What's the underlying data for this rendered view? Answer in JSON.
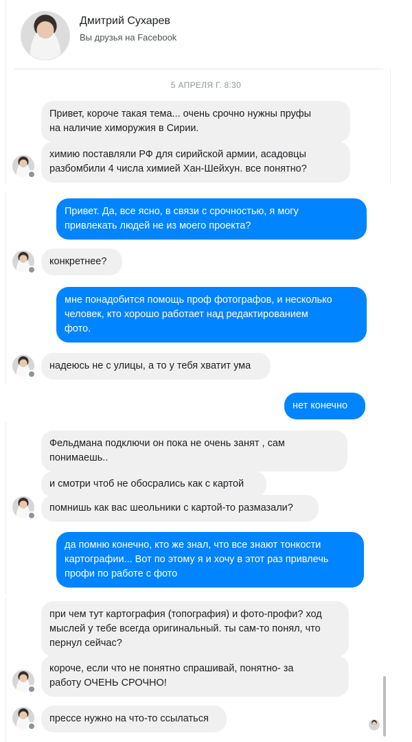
{
  "header": {
    "name": "Дмитрий Сухарев",
    "subtitle": "Вы друзья на Facebook"
  },
  "timestamp": "5 АПРЕЛЯ Г. 8:30",
  "colors": {
    "outgoing": "#0084ff",
    "incoming": "#f1f0f0"
  },
  "messages": [
    {
      "dir": "in",
      "text": "Привет, короче такая тема... очень срочно нужны пруфы\nна наличие химоружия в Сирии."
    },
    {
      "dir": "in",
      "text": "химию поставляли РФ для  сирийской армии, асадовцы\nразбомбили 4 числа химией  Хан-Шейхун. все понятно?"
    },
    {
      "dir": "out",
      "text": "Привет. Да, все ясно, в связи с срочностью, я могу\nпривлекать людей не из моего проекта?"
    },
    {
      "dir": "in",
      "text": "конкретнее?"
    },
    {
      "dir": "out",
      "text": "мне понадобится помощь проф фотографов, и несколько\nчеловек, кто хорошо работает над редактированием\nфото."
    },
    {
      "dir": "in",
      "text": "надеюсь не с улицы, а то у тебя хватит ума"
    },
    {
      "dir": "out",
      "text": "нет конечно"
    },
    {
      "dir": "in",
      "text": "Фельдмана подключи он пока не очень занят , сам\nпонимаешь.."
    },
    {
      "dir": "in",
      "text": "и смотри чтоб не обосрались как с картой"
    },
    {
      "dir": "in",
      "text": "помнишь как вас шеольники с картой-то размазали?"
    },
    {
      "dir": "out",
      "text": "да помню конечно, кто же знал, что все знают тонкости\nкартографии... Вот по этому я и хочу в этот раз привлечь\nпрофи по работе с фото"
    },
    {
      "dir": "in",
      "text": "при чем тут картография (топография) и фото-профи? ход\nмыслей у тебе всегда оригинальный. ты сам-то понял, что\nпернул сейчас?"
    },
    {
      "dir": "in",
      "text": "короче, если что не понятно спрашивай, понятно- за\nработу ОЧЕНЬ СРОЧНО!"
    },
    {
      "dir": "in",
      "text": "прессе нужно на что-то ссылаться"
    }
  ]
}
